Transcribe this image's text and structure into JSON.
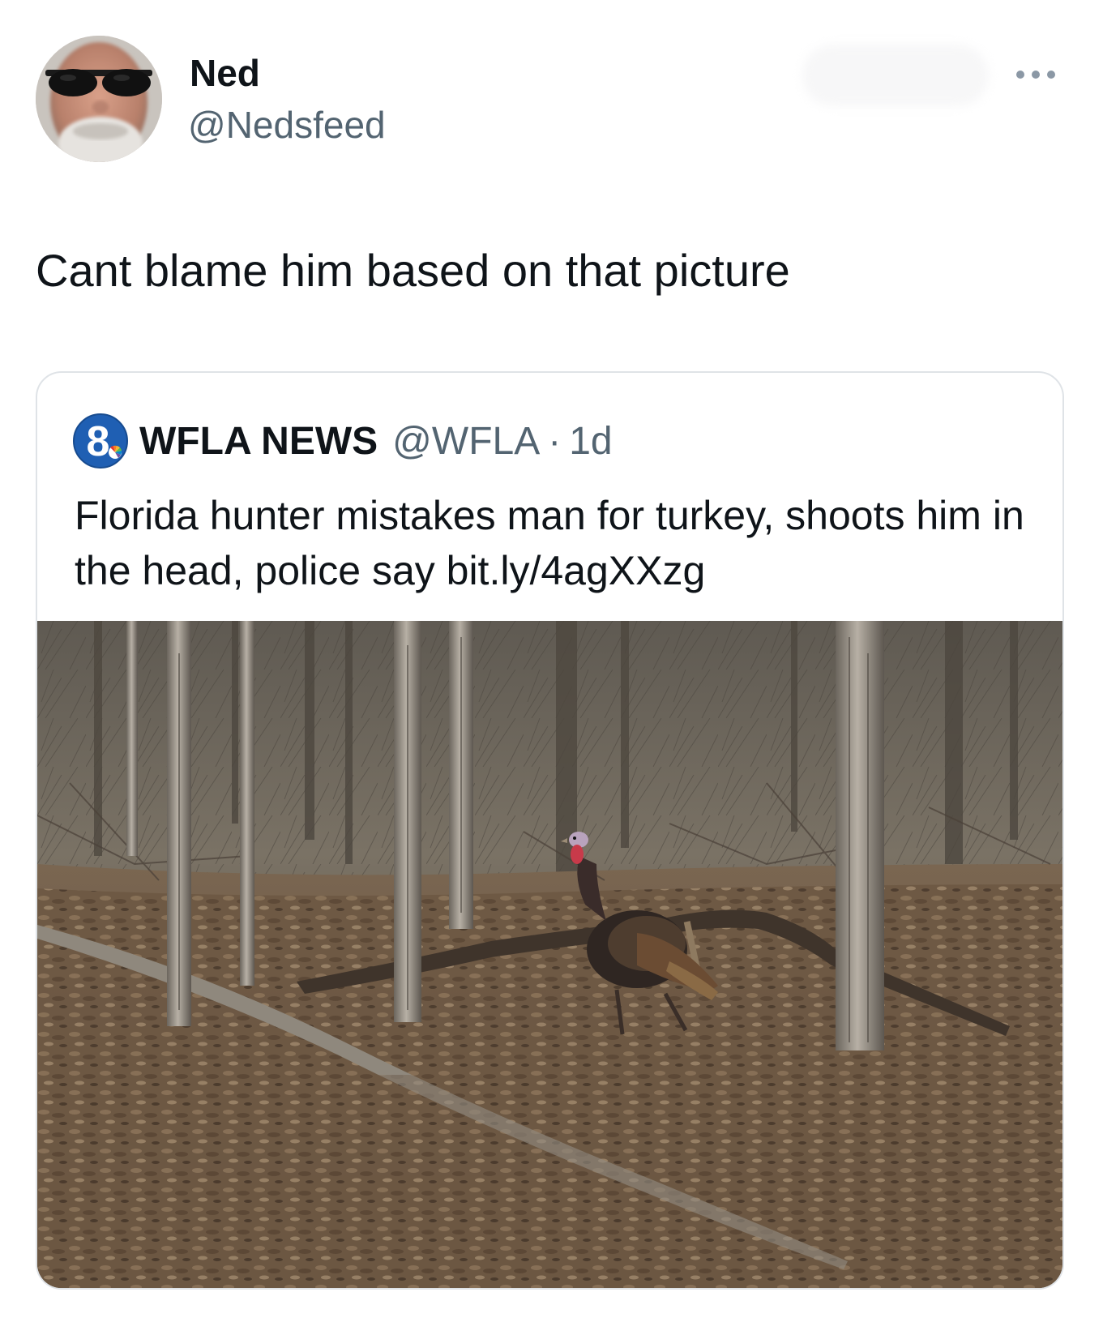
{
  "author": {
    "name": "Ned",
    "handle": "@Nedsfeed"
  },
  "tweet": {
    "text": "Cant blame him based on that picture"
  },
  "quoted_tweet": {
    "author_name": "WFLA NEWS",
    "author_handle": "@WFLA",
    "separator": "·",
    "timestamp": "1d",
    "logo_text": "8",
    "text": "Florida hunter mistakes man for turkey, shoots him in the head, police say bit.ly/4agXXzg"
  },
  "icons": {
    "more": "more-horizontal-icon",
    "avatar": "user-avatar-image",
    "media": "forest-turkey-photo"
  },
  "colors": {
    "text_primary": "#0f1419",
    "text_secondary": "#536471",
    "card_border": "#dfe3e7",
    "wfla_blue": "#1f5fb3"
  }
}
